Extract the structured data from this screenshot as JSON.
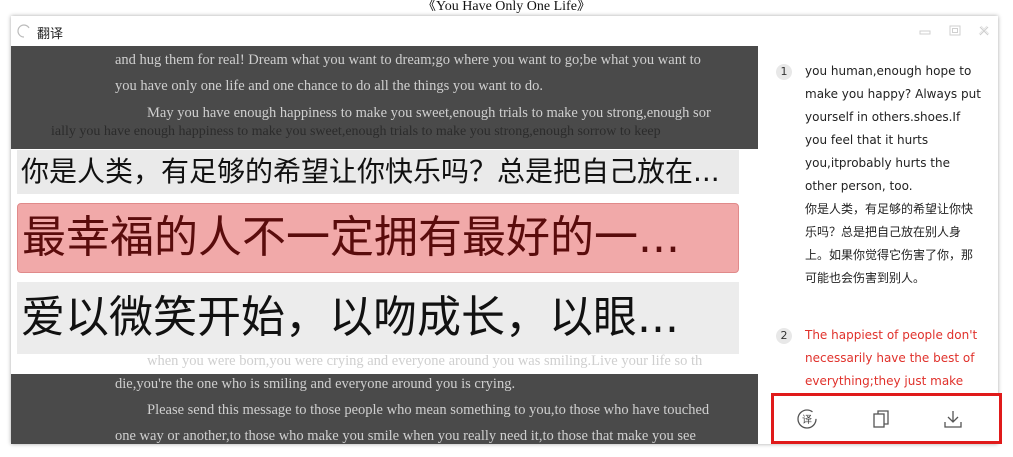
{
  "document": {
    "title": "《You Have Only One Life》",
    "lines": [
      "and hug them for real! Dream what you want to dream;go where you want to go;be what you want to",
      "you have only one life and one chance to do all the things you want to do.",
      "May you have enough happiness to make you sweet,enough trials to make you strong,enough sor",
      "when you were born,you were crying and everyone around you was smiling.Live your life so th",
      "die,you're the one who is smiling and everyone around you is crying.",
      "Please send this message to those people who mean something to you,to those who have touched",
      "one way or another,to those who make you smile when you really need it,to those that make you see"
    ],
    "ghost_line": "ially you have enough happiness to make you sweet,enough trials to make you strong,enough sorrow to keep"
  },
  "window": {
    "app_title": "翻译",
    "controls": [
      "minimize-icon",
      "maximize-icon",
      "close-icon"
    ]
  },
  "capture": {
    "lines": [
      "你是人类，有足够的希望让你快乐吗？总是把自己放在...",
      "最幸福的人不一定拥有最好的一...",
      "爱以微笑开始，以吻成长，以眼..."
    ],
    "highlight_color": "#f1a9a9"
  },
  "results": {
    "entries": [
      {
        "num": "1",
        "en": "you human,enough hope to make you happy? Always put yourself in others.shoes.If you feel that it hurts you,itprobably hurts the other person, too.",
        "zh": "你是人类，有足够的希望让你快乐吗？总是把自己放在别人身上。如果你觉得它伤害了你，那可能也会伤害到别人。"
      },
      {
        "num": "2",
        "en": "The happiest of people don't necessarily have the best of everything;they just make the"
      }
    ],
    "active_color": "#e0312b"
  },
  "toolbar": {
    "translate_icon_label": "译",
    "buttons": [
      "translate-icon",
      "copy-icon",
      "download-icon"
    ],
    "border_color": "#e01a1a"
  }
}
